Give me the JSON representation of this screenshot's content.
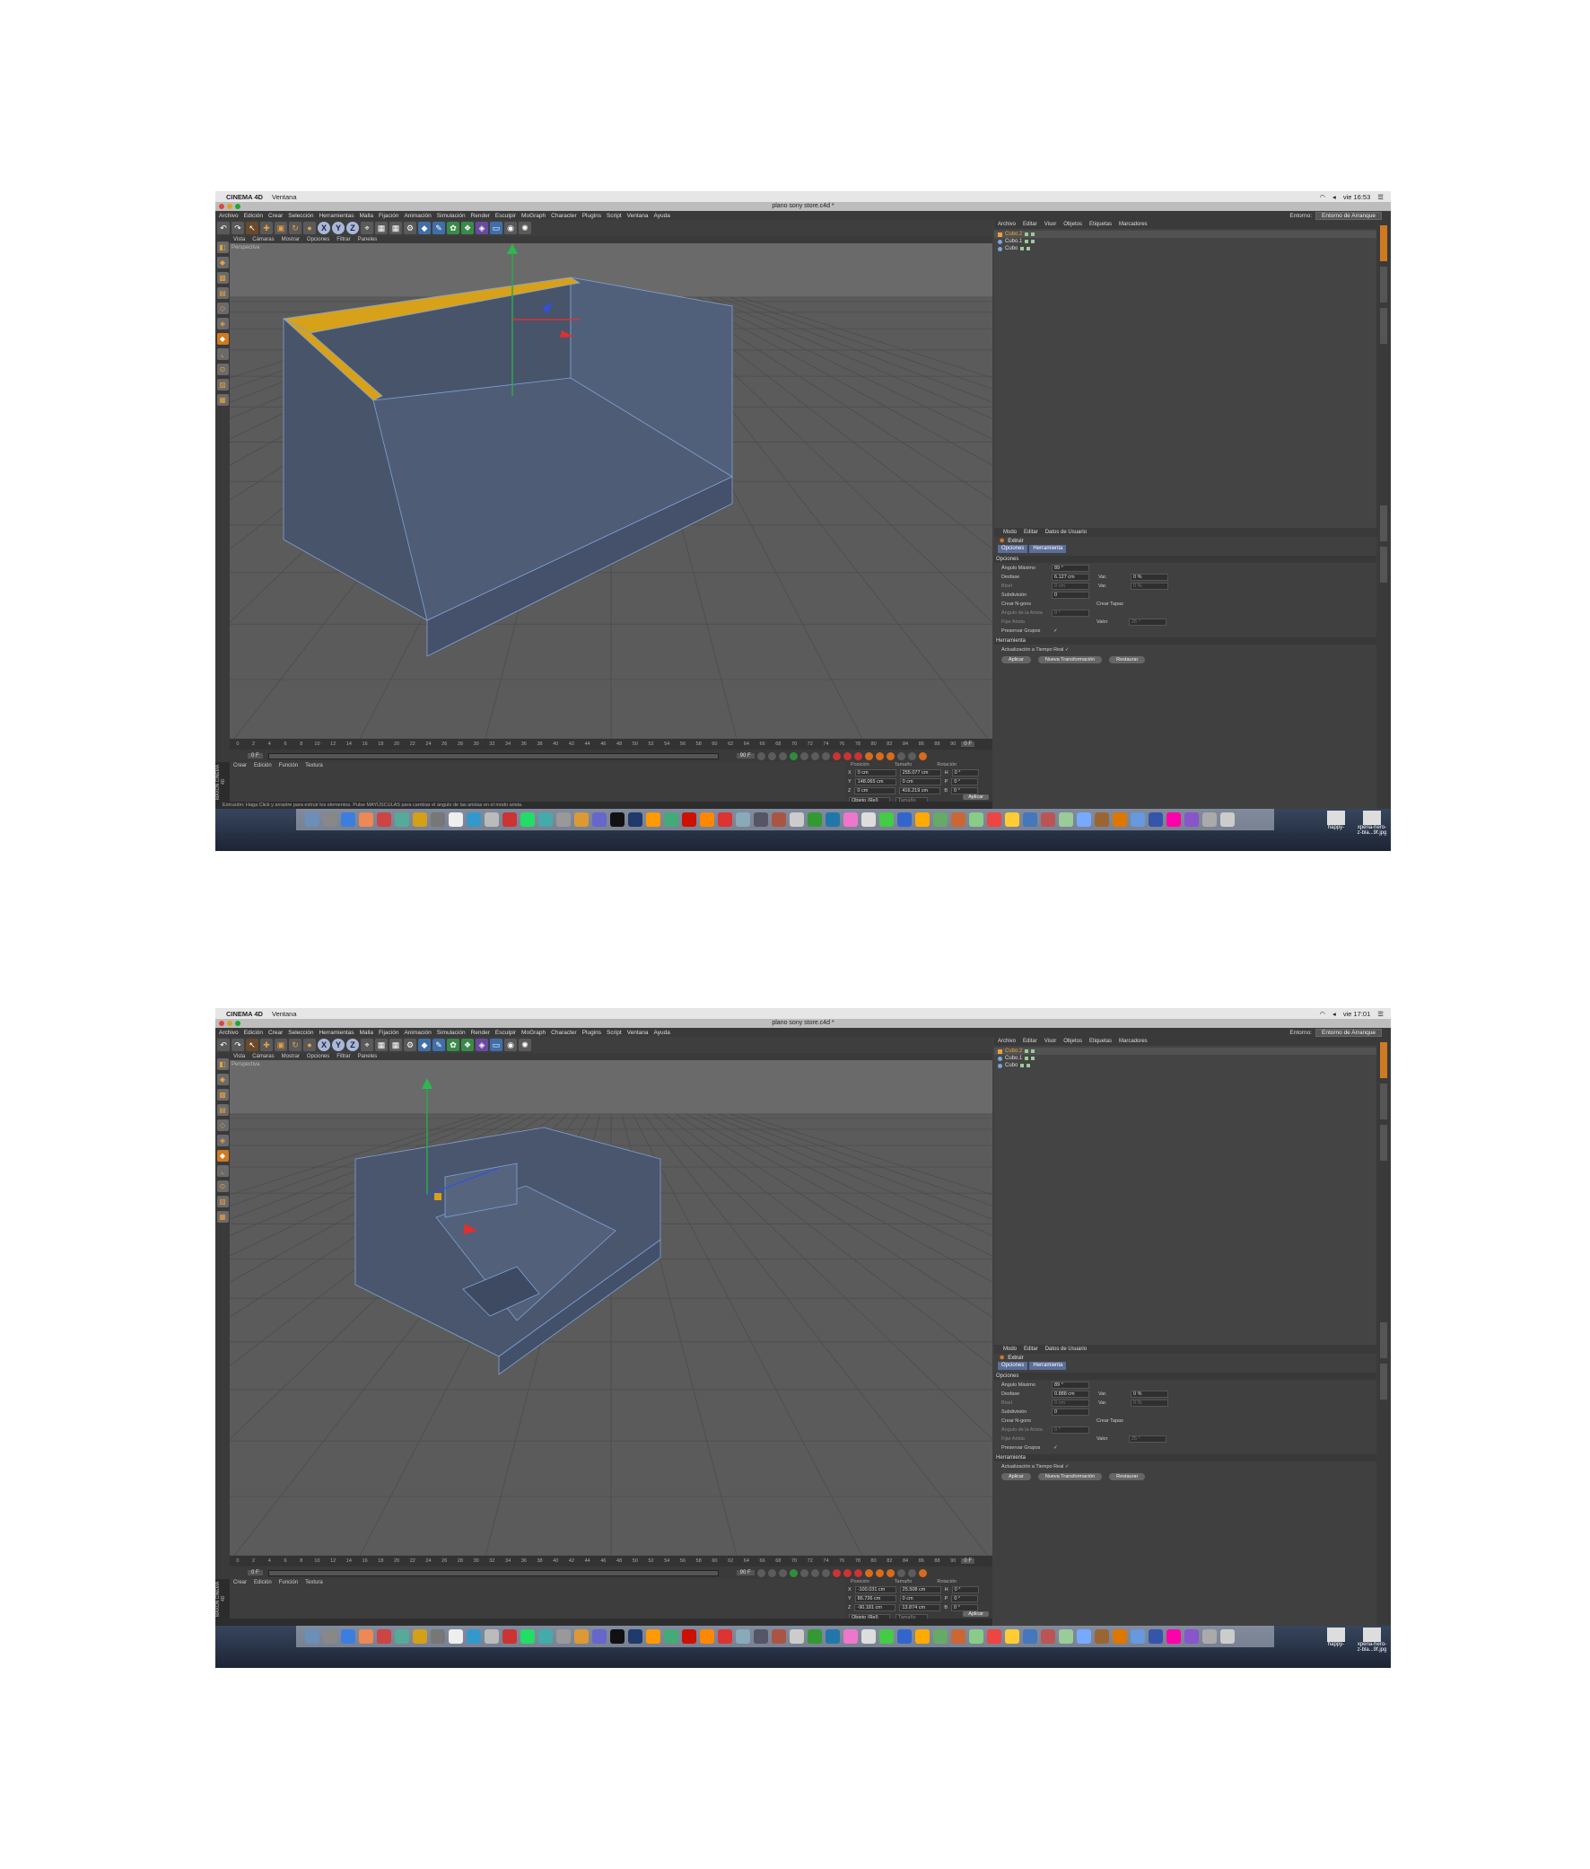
{
  "screens": [
    {
      "os": {
        "app_name": "CINEMA 4D",
        "menu": "Ventana",
        "clock": "vie 16:53"
      },
      "window_title": "plano sony store.c4d *",
      "main_menu": [
        "Archivo",
        "Edición",
        "Crear",
        "Selección",
        "Herramientas",
        "Malla",
        "Fijación",
        "Animación",
        "Simulación",
        "Render",
        "Esculpir",
        "MoGraph",
        "Character",
        "Plugins",
        "Script",
        "Ventana",
        "Ayuda"
      ],
      "environment": {
        "label": "Entorno:",
        "value": "Entorno de Arranque"
      },
      "viewport_menu": [
        "Vista",
        "Cámaras",
        "Mostrar",
        "Opciones",
        "Filtrar",
        "Paneles"
      ],
      "viewport_label": "Perspectiva",
      "timeline_ticks": [
        "0",
        "2",
        "4",
        "6",
        "8",
        "10",
        "12",
        "14",
        "16",
        "18",
        "20",
        "22",
        "24",
        "26",
        "28",
        "30",
        "32",
        "34",
        "36",
        "38",
        "40",
        "42",
        "44",
        "46",
        "48",
        "50",
        "52",
        "54",
        "56",
        "58",
        "60",
        "62",
        "64",
        "66",
        "68",
        "70",
        "72",
        "74",
        "76",
        "78",
        "80",
        "82",
        "84",
        "86",
        "88",
        "90"
      ],
      "timeline_end": "0 F",
      "frame_start": "0 F",
      "frame_end": "90 F",
      "material_menu": [
        "Crear",
        "Edición",
        "Función",
        "Textura"
      ],
      "maxon_label": "MAXON CINEMA 4D",
      "coords": {
        "headers": [
          "Posición",
          "Tamaño",
          "Rotación"
        ],
        "rows": [
          {
            "axis": "X",
            "pos": "0 cm",
            "size": "255.077 cm",
            "rot_label": "H",
            "rot": "0 °"
          },
          {
            "axis": "Y",
            "pos": "148.065 cm",
            "size": "0 cm",
            "rot_label": "P",
            "rot": "0 °"
          },
          {
            "axis": "Z",
            "pos": "0 cm",
            "size": "416.219 cm",
            "rot_label": "B",
            "rot": "0 °"
          }
        ],
        "mode": "Objeto (Rel)",
        "size_mode": "Tamaño",
        "apply": "Aplicar"
      },
      "status": "Extrusión: Haga Click y arrastre para extruir los elementos. Pulse MAYÚSCULAS para cambiar el ángulo de las aristas en el modo arista.",
      "obj_menu": [
        "Archivo",
        "Editar",
        "Visor",
        "Objetos",
        "Etiquetas",
        "Marcadores"
      ],
      "objects": [
        {
          "name": "Cubo.2",
          "selected": true
        },
        {
          "name": "Cubo.1",
          "selected": false
        },
        {
          "name": "Cubo",
          "selected": false
        }
      ],
      "attr_menu": [
        "Modo",
        "Editar",
        "Datos de Usuario"
      ],
      "tool_name": "Extruir",
      "tabs": [
        "Opciones",
        "Herramienta"
      ],
      "section_options": "Opciones",
      "attrs": [
        {
          "label": "Ángulo Máximo",
          "value": "89 °",
          "label2": "",
          "value2": "",
          "dim": false
        },
        {
          "label": "Desfase",
          "value": "6.127 cm",
          "label2": "Var.",
          "value2": "0 %",
          "dim": false
        },
        {
          "label": "Bisel",
          "value": "0 cm",
          "label2": "Var.",
          "value2": "0 %",
          "dim": true
        },
        {
          "label": "Subdivisión",
          "value": "0",
          "label2": "",
          "value2": "",
          "dim": false
        },
        {
          "label": "Crear N-gons",
          "value": "",
          "label2": "Crear Tapas",
          "value2": "",
          "dim": false
        },
        {
          "label": "Ángulo de la Arista",
          "value": "0 °",
          "label2": "",
          "value2": "",
          "dim": true
        },
        {
          "label": "Fijar Arista",
          "value": "",
          "label2": "Valor",
          "value2": "25 °",
          "dim": true
        },
        {
          "label": "Preservar Grupos",
          "value": "✓",
          "label2": "",
          "value2": "",
          "dim": false
        }
      ],
      "section_tool": "Herramienta",
      "realtime": "Actualización a Tiempo Real ✓",
      "buttons": [
        "Aplicar",
        "Nueva Transformación",
        "Restaurar"
      ],
      "desktop_files": [
        "happy-",
        "xperia-hero-z-bla...9f.jpg"
      ]
    },
    {
      "os": {
        "app_name": "CINEMA 4D",
        "menu": "Ventana",
        "clock": "vie 17:01"
      },
      "window_title": "plano sony store.c4d *",
      "main_menu": [
        "Archivo",
        "Edición",
        "Crear",
        "Selección",
        "Herramientas",
        "Malla",
        "Fijación",
        "Animación",
        "Simulación",
        "Render",
        "Esculpir",
        "MoGraph",
        "Character",
        "Plugins",
        "Script",
        "Ventana",
        "Ayuda"
      ],
      "environment": {
        "label": "Entorno:",
        "value": "Entorno de Arranque"
      },
      "viewport_menu": [
        "Vista",
        "Cámaras",
        "Mostrar",
        "Opciones",
        "Filtrar",
        "Paneles"
      ],
      "viewport_label": "Perspectiva",
      "timeline_ticks": [
        "0",
        "2",
        "4",
        "6",
        "8",
        "10",
        "12",
        "14",
        "16",
        "18",
        "20",
        "22",
        "24",
        "26",
        "28",
        "30",
        "32",
        "34",
        "36",
        "38",
        "40",
        "42",
        "44",
        "46",
        "48",
        "50",
        "52",
        "54",
        "56",
        "58",
        "60",
        "62",
        "64",
        "66",
        "68",
        "70",
        "72",
        "74",
        "76",
        "78",
        "80",
        "82",
        "84",
        "86",
        "88",
        "90"
      ],
      "timeline_end": "0 F",
      "frame_start": "0 F",
      "frame_end": "90 F",
      "material_menu": [
        "Crear",
        "Edición",
        "Función",
        "Textura"
      ],
      "maxon_label": "MAXON CINEMA 4D",
      "coords": {
        "headers": [
          "Posición",
          "Tamaño",
          "Rotación"
        ],
        "rows": [
          {
            "axis": "X",
            "pos": "-100.031 cm",
            "size": "25.508 cm",
            "rot_label": "H",
            "rot": "0 °"
          },
          {
            "axis": "Y",
            "pos": "86.726 cm",
            "size": "0 cm",
            "rot_label": "P",
            "rot": "0 °"
          },
          {
            "axis": "Z",
            "pos": "-90.181 cm",
            "size": "13.874 cm",
            "rot_label": "B",
            "rot": "0 °"
          }
        ],
        "mode": "Objeto (Rel)",
        "size_mode": "Tamaño",
        "apply": "Aplicar"
      },
      "status": "",
      "obj_menu": [
        "Archivo",
        "Editar",
        "Visor",
        "Objetos",
        "Etiquetas",
        "Marcadores"
      ],
      "objects": [
        {
          "name": "Cubo.2",
          "selected": true
        },
        {
          "name": "Cubo.1",
          "selected": false
        },
        {
          "name": "Cubo",
          "selected": false
        }
      ],
      "attr_menu": [
        "Modo",
        "Editar",
        "Datos de Usuario"
      ],
      "tool_name": "Extruir",
      "tabs": [
        "Opciones",
        "Herramienta"
      ],
      "section_options": "Opciones",
      "attrs": [
        {
          "label": "Ángulo Máximo",
          "value": "89 °",
          "label2": "",
          "value2": "",
          "dim": false
        },
        {
          "label": "Desfase",
          "value": "0.888 cm",
          "label2": "Var.",
          "value2": "0 %",
          "dim": false
        },
        {
          "label": "Bisel",
          "value": "0 cm",
          "label2": "Var.",
          "value2": "0 %",
          "dim": true
        },
        {
          "label": "Subdivisión",
          "value": "0",
          "label2": "",
          "value2": "",
          "dim": false
        },
        {
          "label": "Crear N-gons",
          "value": "",
          "label2": "Crear Tapas",
          "value2": "",
          "dim": false
        },
        {
          "label": "Ángulo de la Arista",
          "value": "0 °",
          "label2": "",
          "value2": "",
          "dim": true
        },
        {
          "label": "Fijar Arista",
          "value": "",
          "label2": "Valor",
          "value2": "25 °",
          "dim": true
        },
        {
          "label": "Preservar Grupos",
          "value": "✓",
          "label2": "",
          "value2": "",
          "dim": false
        }
      ],
      "section_tool": "Herramienta",
      "realtime": "Actualización a Tiempo Real ✓",
      "buttons": [
        "Aplicar",
        "Nueva Transformación",
        "Restaurar"
      ],
      "desktop_files": [
        "happy-",
        "xperia-hero-z-bla...9f.jpg"
      ]
    }
  ],
  "colors": {
    "accent_orange": "#d07a20",
    "tab_blue": "#5b6d99",
    "mesh_face": "#4d5a72",
    "mesh_wire": "#7ea3d6",
    "selection_yellow": "#d7a11a"
  }
}
